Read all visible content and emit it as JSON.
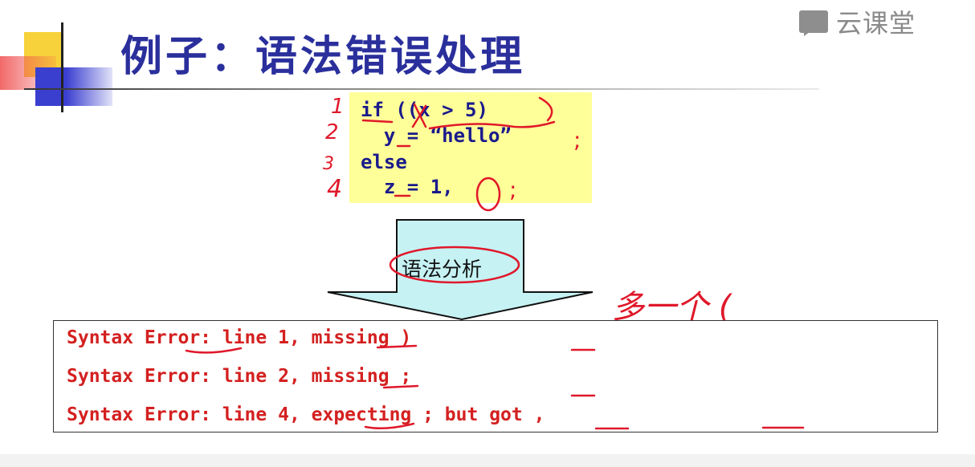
{
  "brand": {
    "icon": "book-icon",
    "name": "云课堂"
  },
  "slide": {
    "title": "例子：语法错误处理",
    "code": {
      "lines": [
        "if ((x > 5)",
        "  y = “hello”",
        "else",
        "  z = 1,"
      ],
      "line_numbers": [
        "1",
        "2",
        "3",
        "4"
      ],
      "extra_semicolons": [
        ";",
        ";"
      ]
    },
    "arrow_label": "语法分析",
    "note": "多一个 (",
    "errors": [
      "Syntax Error: line 1, missing )",
      "Syntax Error: line 2, missing ;",
      "Syntax Error: line 4, expecting ; but got ,"
    ],
    "colors": {
      "title": "#2a2f9c",
      "code_bg": "#ffff99",
      "code_text": "#1a1a8c",
      "error_text": "#d42020",
      "ink": "#e0182a",
      "arrow_fill": "#c6f2f4"
    }
  }
}
